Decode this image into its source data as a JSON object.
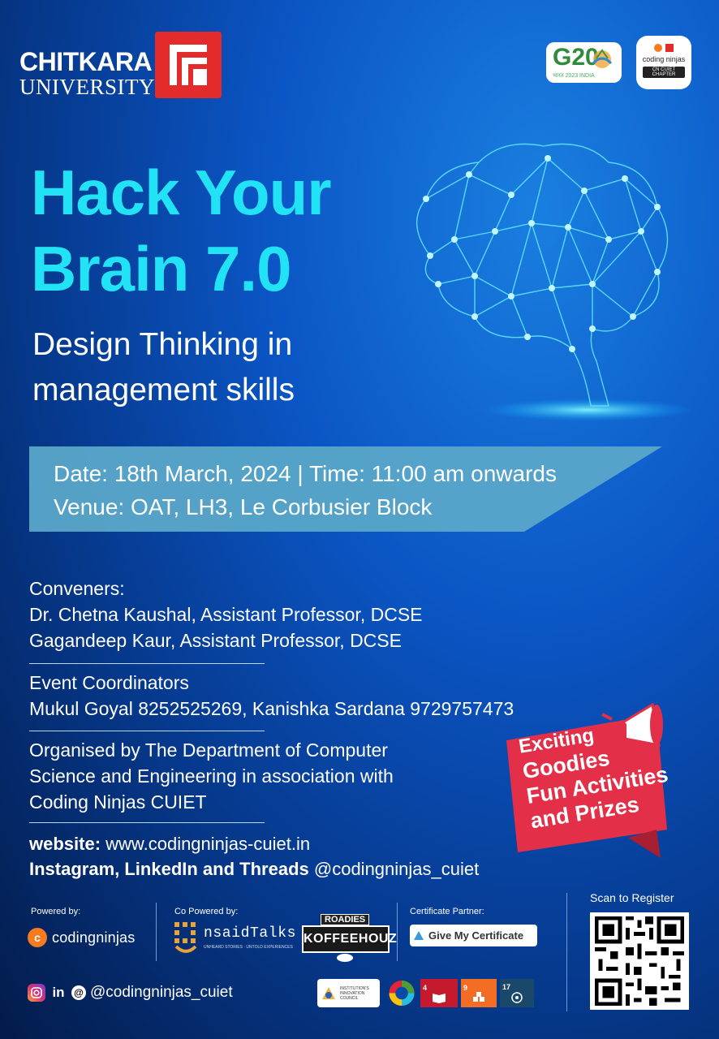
{
  "header": {
    "university_name": "CHITKARA",
    "university_sub": "UNIVERSITY",
    "g20_text": "G20",
    "g20_sub": "भारत 2023 INDIA",
    "chapter_badge_name": "coding ninjas",
    "chapter_badge_sub": "CN CUIET CHAPTER"
  },
  "event": {
    "title_line1": "Hack Your",
    "title_line2": "Brain 7.0",
    "subtitle_line1": "Design Thinking in",
    "subtitle_line2": "management skills",
    "date_time": "Date: 18th March, 2024  |  Time: 11:00 am onwards",
    "venue": "Venue: OAT, LH3, Le Corbusier Block"
  },
  "conveners": {
    "heading": "Conveners:",
    "items": [
      "Dr. Chetna Kaushal, Assistant Professor, DCSE",
      "Gagandeep Kaur, Assistant Professor, DCSE"
    ]
  },
  "coordinators": {
    "heading": "Event Coordinators",
    "text": "Mukul Goyal 8252525269,  Kanishka Sardana 9729757473"
  },
  "organiser": {
    "lines": [
      "Organised by The Department of Computer",
      "Science and Engineering in association with",
      "Coding Ninjas CUIET"
    ]
  },
  "links": {
    "website_label": "website:",
    "website_url": "www.codingninjas-cuiet.in",
    "social_label": "Instagram, LinkedIn and Threads",
    "social_handle": "@codingninjas_cuiet"
  },
  "promo": {
    "line1": "Exciting",
    "line2": "Goodies",
    "line3": "Fun Activities",
    "line4": "and Prizes"
  },
  "footer": {
    "powered_by_label": "Powered by:",
    "powered_by_name": "codingninjas",
    "co_powered_label": "Co Powered by:",
    "nsaid_name": "nsaidTalks",
    "nsaid_tag": "UNHEARD STORIES · UNTOLD EXPERIENCES",
    "koffee_top": "ROADIES",
    "koffee_name": "KOFFEEHOUZ",
    "certificate_label": "Certificate Partner:",
    "certificate_name": "Give My Certificate",
    "scan_label": "Scan to Register",
    "social_handle": "@codingninjas_cuiet",
    "iic_text": "INSTITUTION'S INNOVATION COUNCIL",
    "sdg_4": "4",
    "sdg_9": "9",
    "sdg_17": "17"
  },
  "colors": {
    "title": "#22e3f5",
    "band": "#5aa6c9",
    "promo": "#e42f48",
    "logo_red": "#e32b2b"
  }
}
